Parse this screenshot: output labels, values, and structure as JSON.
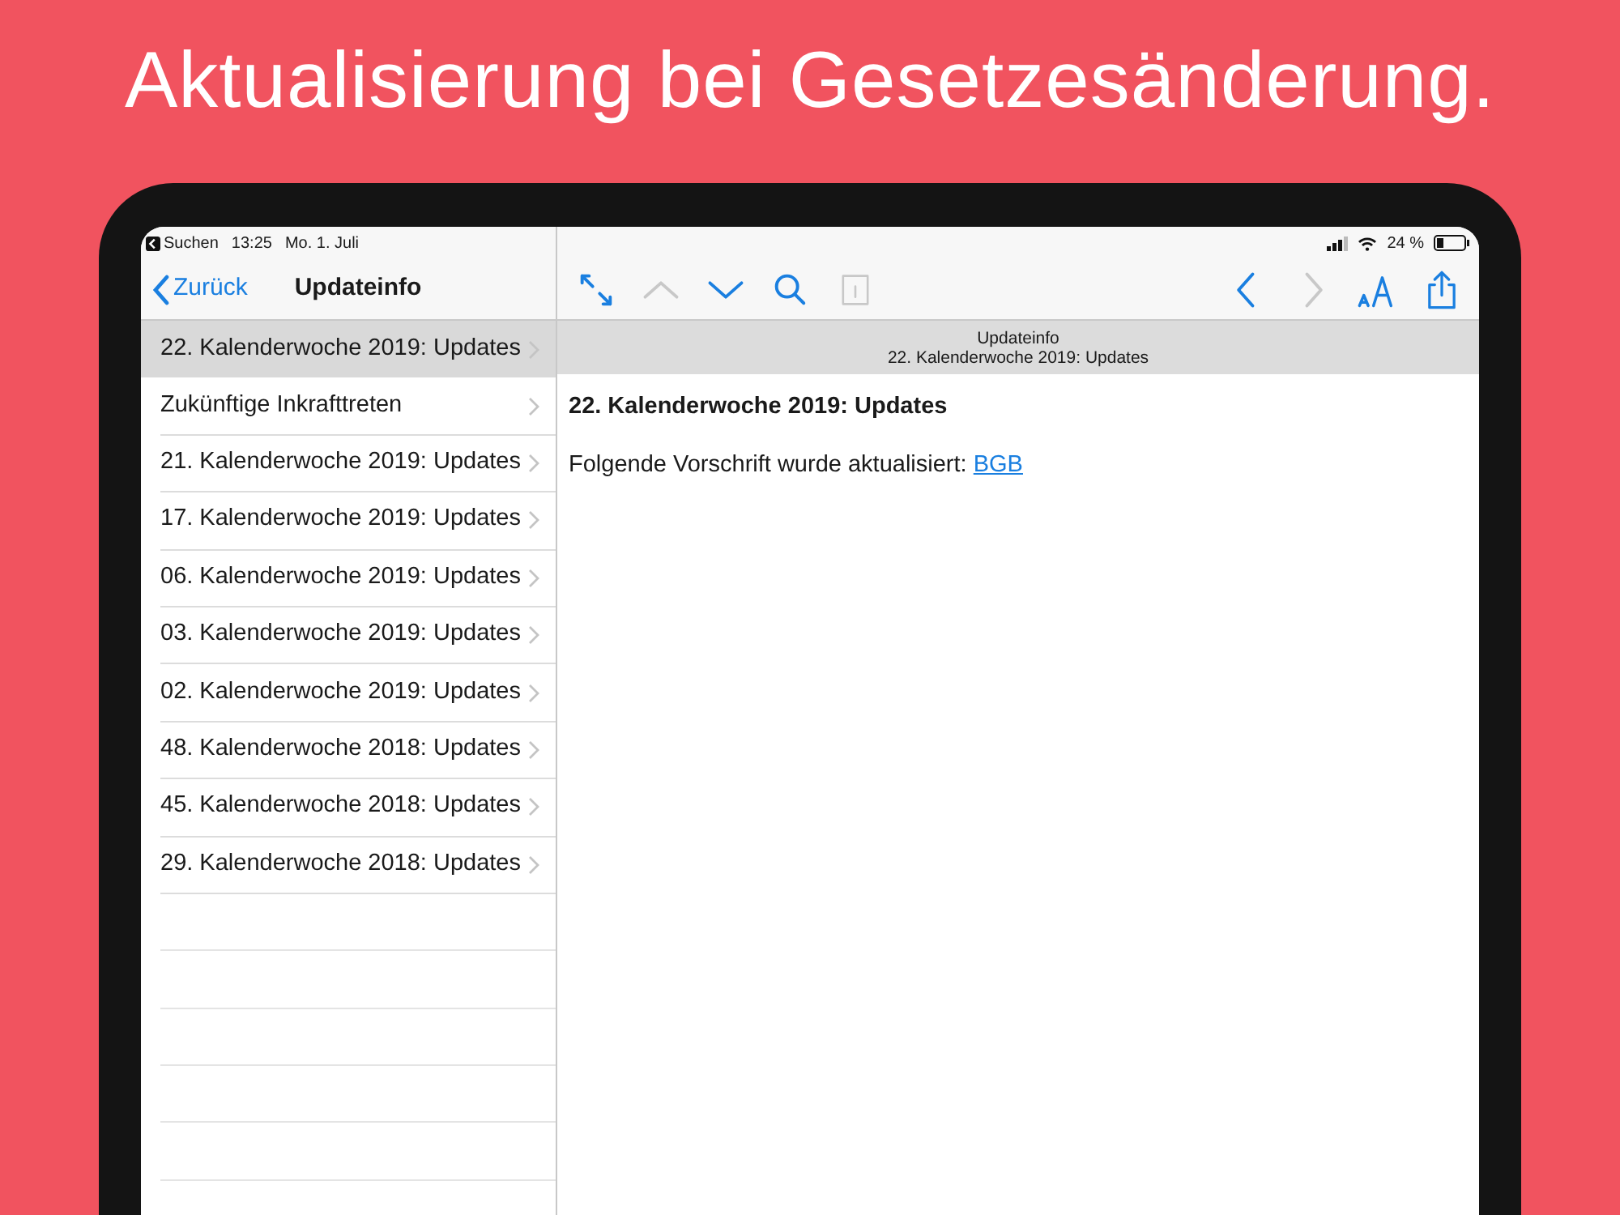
{
  "headline": "Aktualisierung bei Gesetzesänderung.",
  "status_bar": {
    "back_app": "Suchen",
    "time": "13:25",
    "date": "Mo. 1. Juli",
    "battery": "24 %"
  },
  "nav": {
    "back": "Zurück",
    "title": "Updateinfo"
  },
  "toolbar": [
    {
      "kind": "expand",
      "disabled": false
    },
    {
      "kind": "up",
      "disabled": true
    },
    {
      "kind": "down",
      "disabled": false
    },
    {
      "kind": "search",
      "disabled": false
    },
    {
      "kind": "calendar",
      "disabled": true
    },
    {
      "kind": "spacer"
    },
    {
      "kind": "back",
      "disabled": false
    },
    {
      "kind": "forward",
      "disabled": true
    },
    {
      "kind": "font",
      "disabled": false
    },
    {
      "kind": "share",
      "disabled": false
    }
  ],
  "list": [
    {
      "label": "22. Kalenderwoche 2019: Updates",
      "selected": true
    },
    {
      "label": "Zukünftige Inkrafttreten",
      "selected": false
    },
    {
      "label": "21. Kalenderwoche 2019: Updates",
      "selected": false
    },
    {
      "label": "17. Kalenderwoche 2019: Updates",
      "selected": false
    },
    {
      "label": "06. Kalenderwoche 2019: Updates",
      "selected": false
    },
    {
      "label": "03. Kalenderwoche 2019: Updates",
      "selected": false
    },
    {
      "label": "02. Kalenderwoche 2019: Updates",
      "selected": false
    },
    {
      "label": "48. Kalenderwoche 2018: Updates",
      "selected": false
    },
    {
      "label": "45. Kalenderwoche 2018: Updates",
      "selected": false
    },
    {
      "label": "29. Kalenderwoche 2018: Updates",
      "selected": false
    }
  ],
  "detail": {
    "header_title": "Updateinfo",
    "header_subtitle": "22. Kalenderwoche 2019: Updates",
    "heading": "22. Kalenderwoche 2019: Updates",
    "text": "Folgende Vorschrift wurde aktualisiert:",
    "link": "BGB"
  }
}
